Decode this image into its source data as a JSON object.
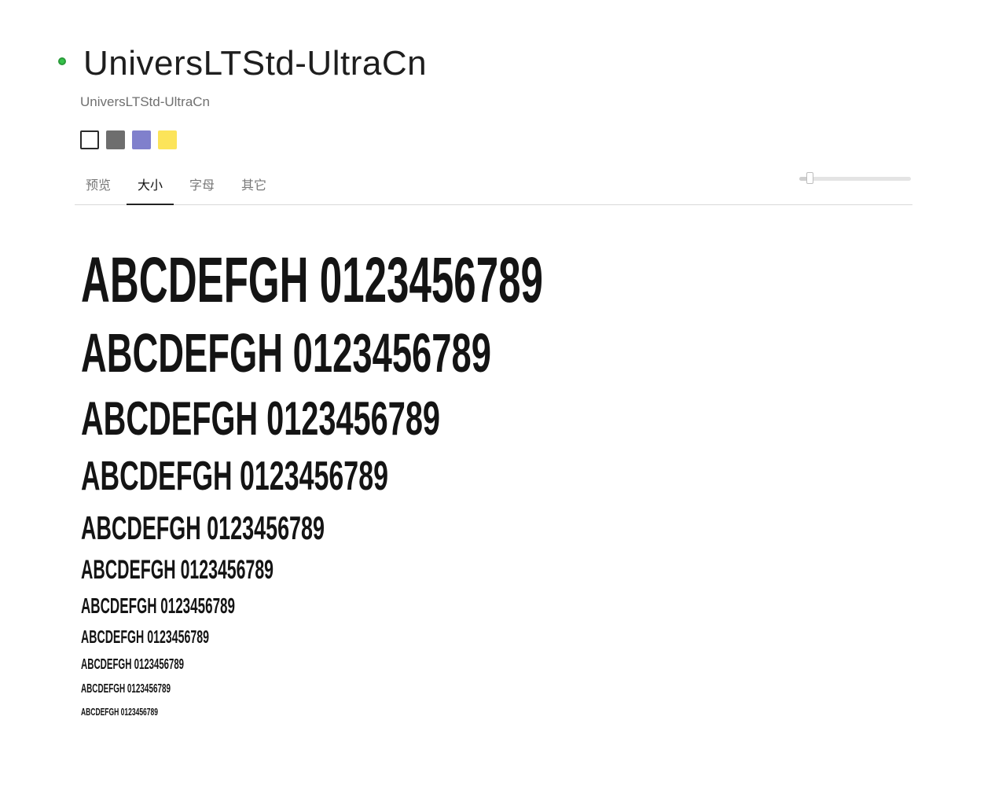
{
  "header": {
    "title": "UniversLTStd-UltraCn",
    "subtitle": "UniversLTStd-UltraCn",
    "status_color": "#35c24a"
  },
  "swatches": [
    {
      "name": "white",
      "color": "#ffffff"
    },
    {
      "name": "gray",
      "color": "#6e6e6e"
    },
    {
      "name": "lavender",
      "color": "#8080cc"
    },
    {
      "name": "yellow",
      "color": "#fce45a"
    }
  ],
  "tabs": [
    {
      "label": "预览",
      "active": false
    },
    {
      "label": "大小",
      "active": true
    },
    {
      "label": "字母",
      "active": false
    },
    {
      "label": "其它",
      "active": false
    }
  ],
  "slider": {
    "value": 0.09
  },
  "samples": [
    {
      "text": "ABCDEFGH 0123456789"
    },
    {
      "text": "ABCDEFGH 0123456789"
    },
    {
      "text": "ABCDEFGH 0123456789"
    },
    {
      "text": "ABCDEFGH 0123456789"
    },
    {
      "text": "ABCDEFGH 0123456789"
    },
    {
      "text": "ABCDEFGH 0123456789"
    },
    {
      "text": "ABCDEFGH 0123456789"
    },
    {
      "text": "ABCDEFGH 0123456789"
    },
    {
      "text": "ABCDEFGH 0123456789"
    },
    {
      "text": "ABCDEFGH 0123456789"
    },
    {
      "text": "ABCDEFGH 0123456789"
    }
  ]
}
